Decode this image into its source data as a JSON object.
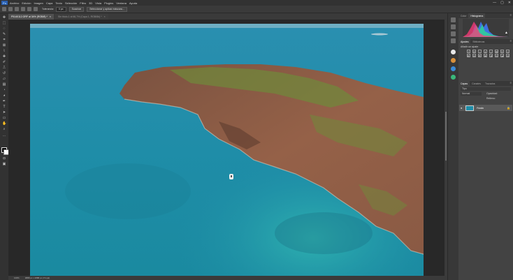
{
  "app": {
    "logo": "Ps"
  },
  "menu": [
    "Archivo",
    "Edición",
    "Imagen",
    "Capa",
    "Texto",
    "Selección",
    "Filtro",
    "3D",
    "Vista",
    "Plugins",
    "Ventana",
    "Ayuda"
  ],
  "window_controls": {
    "minimize": "—",
    "maximize": "▢",
    "close": "✕"
  },
  "options_bar": {
    "tolerance_label": "Tolerancia:",
    "tolerance_value": "0 px",
    "subtract_label": "Suavizar",
    "select_and_mask": "Seleccionar y aplicar máscara..."
  },
  "tabs": [
    {
      "title": "P5140112.ORF al 34% (RGB/8) *",
      "close": "×"
    },
    {
      "title": "Sin título-1 al 66,7% (Capa 1, RGB/8#) *",
      "close": "×"
    }
  ],
  "status": {
    "zoom": "100%",
    "doc_info": "3888 px x 2888 px (72 ppi)"
  },
  "panels": {
    "histogram_tabs": [
      "Color",
      "Histograma"
    ],
    "adjust_tabs": [
      "Ajustes",
      "Bibliotecas"
    ],
    "adjust_subtitle": "Añadir un ajuste",
    "adjust_icons": [
      "☀",
      "▥",
      "◐",
      "▲",
      "◑",
      "▦",
      "⚖",
      "◎",
      "◧",
      "▤",
      "◩",
      "▣",
      "◨",
      "▧",
      "◪",
      "▨"
    ],
    "layers_tabs": [
      "Capas",
      "Canales",
      "Trazados"
    ],
    "layers_filter": "Tipo",
    "blend_mode": "Normal",
    "opacity": "Opacidad:",
    "fill": "Relleno:",
    "layer_name": "Fondo",
    "lock_icon": "lock-icon"
  },
  "colors": {
    "sea": "#1d8fa6",
    "sea_deep": "#2386a0",
    "rock": "#8a5a44",
    "vegetation": "#6f8a3a",
    "accent_blue": "#2b5fb0"
  }
}
